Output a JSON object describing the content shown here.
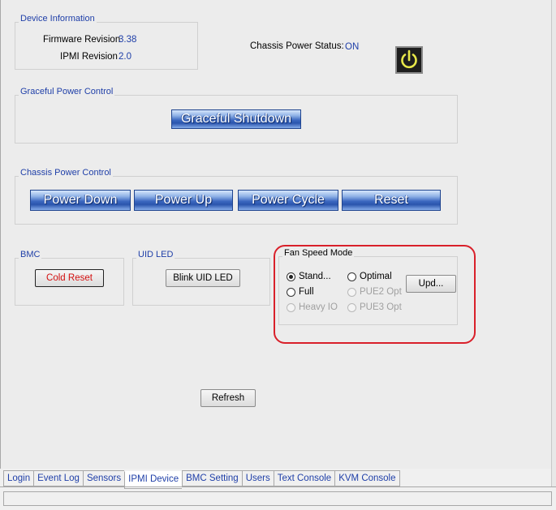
{
  "device_info": {
    "title": "Device Information",
    "firmware_label": "Firmware Revision",
    "firmware_value": "3.38",
    "ipmi_label": "IPMI Revision",
    "ipmi_value": "2.0"
  },
  "chassis_status": {
    "label": "Chassis Power Status:",
    "value": "ON",
    "power_icon": "power-icon",
    "icon_color": "#e8e84a"
  },
  "graceful": {
    "title": "Graceful Power Control",
    "shutdown_label": "Graceful Shutdown"
  },
  "chassis_power": {
    "title": "Chassis Power Control",
    "buttons": [
      "Power Down",
      "Power Up",
      "Power Cycle",
      "Reset"
    ]
  },
  "bmc": {
    "title": "BMC",
    "cold_reset_label": "Cold Reset",
    "cold_reset_color": "#d41010"
  },
  "uid_led": {
    "title": "UID LED",
    "blink_label": "Blink UID LED"
  },
  "fan_speed": {
    "title": "Fan Speed Mode",
    "options": {
      "standard": {
        "label": "Stand...",
        "checked": true,
        "enabled": true
      },
      "optimal": {
        "label": "Optimal",
        "checked": false,
        "enabled": true
      },
      "full": {
        "label": "Full",
        "checked": false,
        "enabled": true
      },
      "pue2": {
        "label": "PUE2 Opt",
        "checked": false,
        "enabled": false
      },
      "heavy_io": {
        "label": "Heavy IO",
        "checked": false,
        "enabled": false
      },
      "pue3": {
        "label": "PUE3 Opt",
        "checked": false,
        "enabled": false
      }
    },
    "update_label": "Upd...",
    "highlight_color": "#d9202a"
  },
  "refresh_label": "Refresh",
  "tabs": [
    {
      "label": "Login",
      "active": false
    },
    {
      "label": "Event Log",
      "active": false
    },
    {
      "label": "Sensors",
      "active": false
    },
    {
      "label": "IPMI Device",
      "active": true
    },
    {
      "label": "BMC Setting",
      "active": false
    },
    {
      "label": "Users",
      "active": false
    },
    {
      "label": "Text Console",
      "active": false
    },
    {
      "label": "KVM Console",
      "active": false
    }
  ]
}
